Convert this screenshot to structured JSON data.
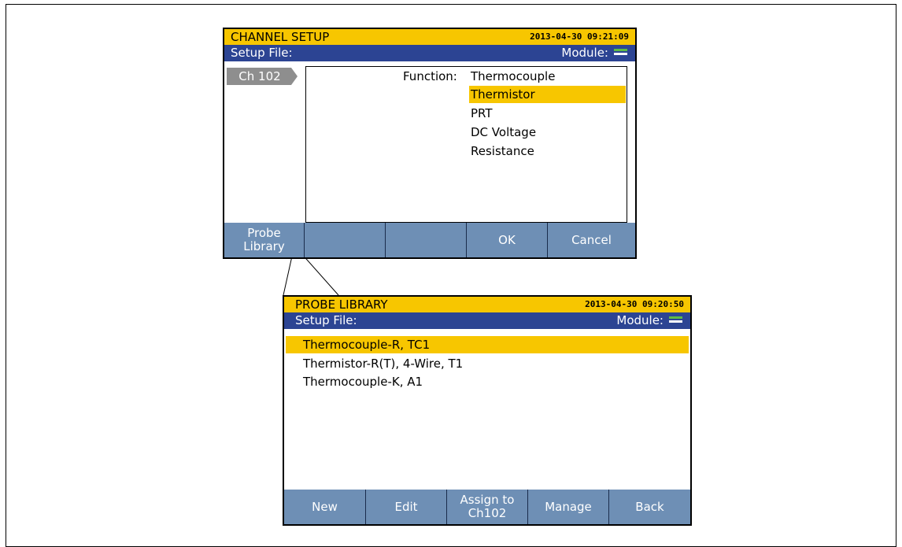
{
  "channel_setup": {
    "title": "CHANNEL SETUP",
    "timestamp": "2013-04-30 09:21:09",
    "setup_file_label": "Setup File:",
    "module_label": "Module:",
    "channel_tab": "Ch 102",
    "function_label": "Function:",
    "options": [
      "Thermocouple",
      "Thermistor",
      "PRT",
      "DC Voltage",
      "Resistance"
    ],
    "selected_option": "Thermistor",
    "buttons": {
      "probe_library_line1": "Probe",
      "probe_library_line2": "Library",
      "ok": "OK",
      "cancel": "Cancel"
    }
  },
  "probe_library": {
    "title": "PROBE LIBRARY",
    "timestamp": "2013-04-30 09:20:50",
    "setup_file_label": "Setup File:",
    "module_label": "Module:",
    "items": [
      "Thermocouple-R, TC1",
      "Thermistor-R(T), 4-Wire, T1",
      "Thermocouple-K, A1"
    ],
    "selected_item": "Thermocouple-R, TC1",
    "buttons": {
      "new": "New",
      "edit": "Edit",
      "assign_line1": "Assign to",
      "assign_line2": "Ch102",
      "manage": "Manage",
      "back": "Back"
    }
  },
  "colors": {
    "title_bar": "#f7c600",
    "sub_bar": "#2c4493",
    "button_bar": "#6e8fb5",
    "selection": "#f7c600",
    "channel_tab": "#8e8e8e",
    "module_icon_green": "#5dbb46"
  },
  "icons": {
    "module": "module-status-icon",
    "callout": "callout-pointer"
  }
}
